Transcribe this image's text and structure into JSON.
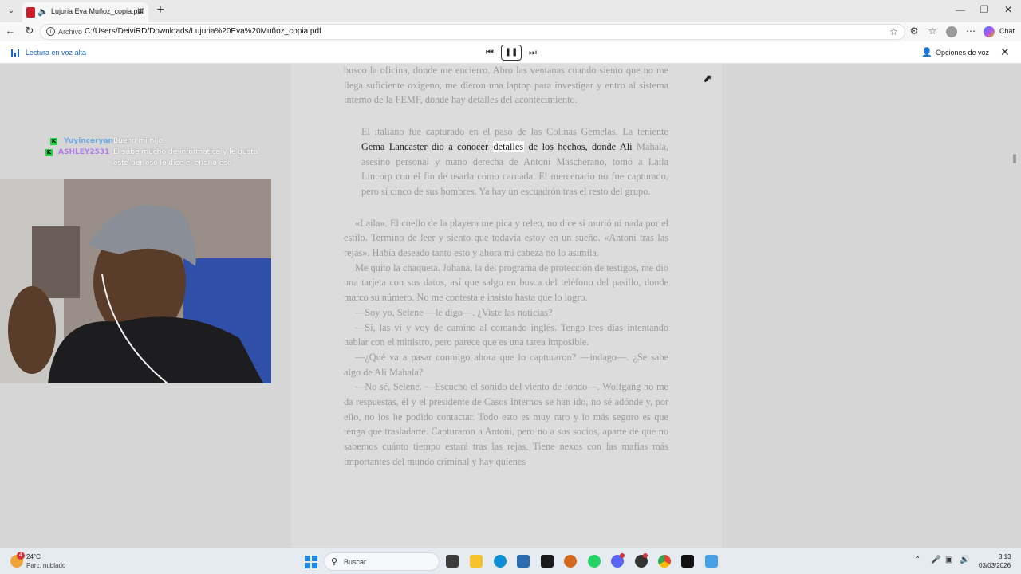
{
  "browser": {
    "tab_title": "Lujuria Eva Muñoz_copia.pdf",
    "address_scheme": "Archivo",
    "address_url": "C:/Users/DeiviRD/Downloads/Lujuria%20Eva%20Muñoz_copia.pdf",
    "chat_label": "Chat"
  },
  "read_aloud": {
    "label": "Lectura en voz alta",
    "voice_options_label": "Opciones de voz"
  },
  "document": {
    "p1": "busco la oficina, donde me encierro. Abro las ventanas cuando siento que no me llega suficiente oxígeno, me dieron una laptop para investigar y entro al sistema interno de la FEMF, donde hay detalles del acontecimiento.",
    "q1_before": "El italiano fue capturado en el paso de las Colinas Gemelas. La teniente ",
    "q1_active_before": "Gema Lancaster dio a conocer ",
    "q1_word": "detalles",
    "q1_active_after": " de los hechos, donde Ali",
    "q1_after": " Mahala, asesino personal y mano derecha de Antoni Mascherano, tomó a Laila Lincorp con el fin de usarla como carnada. El mercenario no fue capturado, pero sí cinco de sus hombres. Ya hay un escuadrón tras el resto del grupo.",
    "p2": "«Laila». El cuello de la playera me pica y releo, no dice si murió ni nada por el estilo. Termino de leer y siento que todavía estoy en un sueño. «Antoni tras las rejas». Había deseado tanto esto y ahora mi cabeza no lo asimila.",
    "p3": "Me quito la chaqueta. Johana, la del programa de protección de testigos, me dio una tarjeta con sus datos, así que salgo en busca del teléfono del pasillo, donde marco su número. No me contesta e insisto hasta que lo logro.",
    "p4": "—Soy yo, Selene —le digo—. ¿Viste las noticias?",
    "p5": "—Sí, las vi y voy de camino al comando inglés. Tengo tres días intentando hablar con el ministro, pero parece que es una tarea imposible.",
    "p6": "—¿Qué va a pasar conmigo ahora que lo capturaron? —indago—. ¿Se sabe algo de Ali Mahala?",
    "p7": "—No sé, Selene. —Escucho el sonido del viento de fondo—. Wolfgang no me da respuestas, él y el presidente de Casos Internos se han ido, no sé adónde y, por ello, no los he podido contactar. Todo esto es muy raro y lo más seguro es que tenga que trasladarte. Capturaron a Antoni, pero no a sus socios, aparte de que no sabemos cuánto tiempo estará tras las rejas. Tiene nexos con las mafias más importantes del mundo criminal y hay quienes"
  },
  "stream_chat": {
    "messages": [
      {
        "user": "Yuyinceryan",
        "text": "Bueno mi hijo.",
        "color": "#6aa9e6"
      },
      {
        "user": "ASHLEY2531",
        "text": "El sabe mucho de informatica y le gusta",
        "color": "#b07be8"
      },
      {
        "user": "",
        "text": "esto por eso lo dice el enano ese",
        "color": "#ffffff"
      }
    ]
  },
  "taskbar": {
    "weather_temp": "24°C",
    "weather_desc": "Parc. nublado",
    "weather_badge": "4",
    "search_placeholder": "Buscar",
    "time": "3:13",
    "date": "03/03/2026"
  }
}
